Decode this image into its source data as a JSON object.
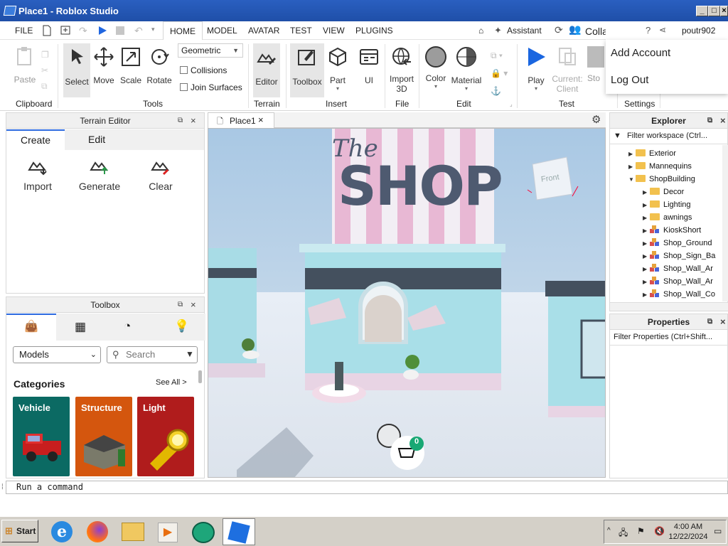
{
  "window": {
    "title": "Place1 - Roblox Studio"
  },
  "menubar": {
    "file": "FILE",
    "tabs": [
      "HOME",
      "MODEL",
      "AVATAR",
      "TEST",
      "VIEW",
      "PLUGINS"
    ],
    "assistant": "Assistant",
    "collaborate": "Collaborate",
    "username": "poutr902"
  },
  "ribbon": {
    "paste": "Paste",
    "clipboard": "Clipboard",
    "select": "Select",
    "move": "Move",
    "scale": "Scale",
    "rotate": "Rotate",
    "snap_mode": "Geometric",
    "collisions": "Collisions",
    "join_surfaces": "Join Surfaces",
    "tools": "Tools",
    "editor": "Editor",
    "terrain": "Terrain",
    "toolbox": "Toolbox",
    "part": "Part",
    "ui": "UI",
    "insert": "Insert",
    "import3d_1": "Import",
    "import3d_2": "3D",
    "file": "File",
    "color": "Color",
    "material": "Material",
    "edit": "Edit",
    "play": "Play",
    "current1": "Current:",
    "current2": "Client",
    "stop": "Sto",
    "test": "Test",
    "settings": "Settings"
  },
  "account_menu": {
    "add": "Add Account",
    "logout": "Log Out"
  },
  "terrain_editor": {
    "title": "Terrain Editor",
    "tabs": [
      "Create",
      "Edit"
    ],
    "actions": [
      "Import",
      "Generate",
      "Clear"
    ]
  },
  "toolbox": {
    "title": "Toolbox",
    "category_select": "Models",
    "search_placeholder": "Search",
    "categories_heading": "Categories",
    "see_all": "See All >",
    "categories": [
      {
        "label": "Vehicle",
        "color": "#0b6a63"
      },
      {
        "label": "Structure",
        "color": "#d4560e"
      },
      {
        "label": "Light",
        "color": "#b01c1c"
      }
    ]
  },
  "viewport": {
    "tab": "Place1",
    "sign_the": "The",
    "sign_shop": "SHOP",
    "cube_label": "Front",
    "cart_count": "0"
  },
  "explorer": {
    "title": "Explorer",
    "filter": "Filter workspace (Ctrl...",
    "items": [
      {
        "label": "Exterior",
        "type": "folder",
        "level": 1,
        "arrow": "▶"
      },
      {
        "label": "Mannequins",
        "type": "folder",
        "level": 1,
        "arrow": "▶"
      },
      {
        "label": "ShopBuilding",
        "type": "folder",
        "level": 1,
        "arrow": "▼"
      },
      {
        "label": "Decor",
        "type": "folder",
        "level": 2,
        "arrow": "▶"
      },
      {
        "label": "Lighting",
        "type": "folder",
        "level": 2,
        "arrow": "▶"
      },
      {
        "label": "awnings",
        "type": "folder",
        "level": 2,
        "arrow": "▶"
      },
      {
        "label": "KioskShort",
        "type": "model",
        "level": 2,
        "arrow": "▶"
      },
      {
        "label": "Shop_Ground",
        "type": "model",
        "level": 2,
        "arrow": "▶"
      },
      {
        "label": "Shop_Sign_Ba",
        "type": "model",
        "level": 2,
        "arrow": "▶"
      },
      {
        "label": "Shop_Wall_Ar",
        "type": "model",
        "level": 2,
        "arrow": "▶"
      },
      {
        "label": "Shop_Wall_Ar",
        "type": "model",
        "level": 2,
        "arrow": "▶"
      },
      {
        "label": "Shop_Wall_Co",
        "type": "model",
        "level": 2,
        "arrow": "▶"
      }
    ]
  },
  "properties": {
    "title": "Properties",
    "filter": "Filter Properties (Ctrl+Shift..."
  },
  "command": {
    "placeholder": "Run a command"
  },
  "taskbar": {
    "start": "Start",
    "time": "4:00 AM",
    "date": "12/22/2024"
  }
}
